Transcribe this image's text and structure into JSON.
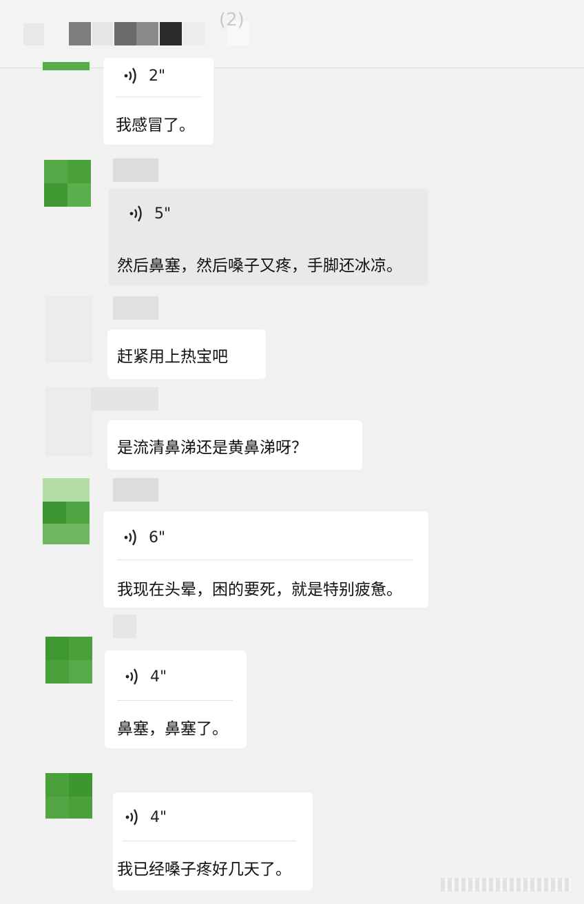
{
  "header": {
    "title_fragment": "(2)"
  },
  "messages": [
    {
      "duration": "2\"",
      "text": "我感冒了。"
    },
    {
      "duration": "5\"",
      "text": "然后鼻塞，然后嗓子又疼，手脚还冰凉。"
    },
    {
      "text": "赶紧用上热宝吧"
    },
    {
      "text": "是流清鼻涕还是黄鼻涕呀？"
    },
    {
      "duration": "6\"",
      "text": "我现在头晕，困的要死，就是特别疲惫。"
    },
    {
      "duration": "4\"",
      "text": "鼻塞，鼻塞了。"
    },
    {
      "duration": "4\"",
      "text": "我已经嗓子疼好几天了。"
    }
  ],
  "colors": {
    "avatar_green": "#4aa03b",
    "bubble_white": "#ffffff",
    "bubble_selected": "#e9e9e9",
    "background": "#f1f1f1"
  }
}
